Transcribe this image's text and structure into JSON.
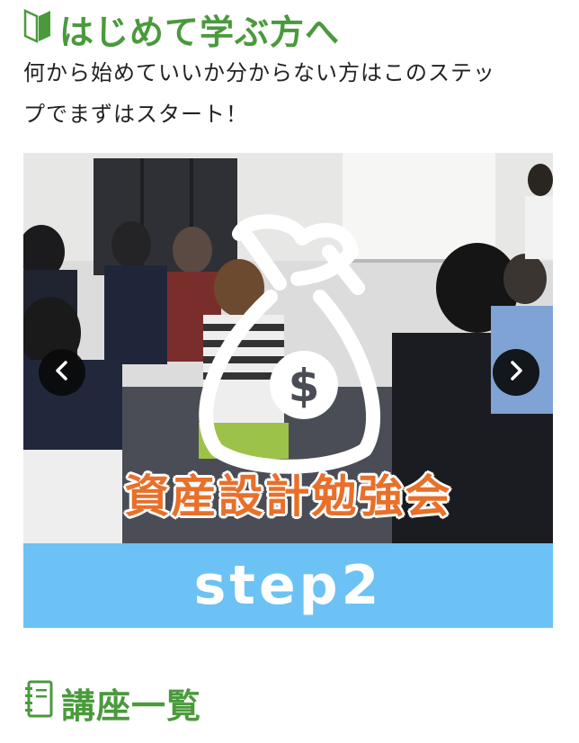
{
  "beginner_section": {
    "heading": "はじめて学ぶ方へ",
    "heading_icon": "beginner-leaf-icon",
    "intro_line_1": "何から始めていいか分からない方はこのステッ",
    "intro_line_2": "プでまずはスタート！"
  },
  "slider": {
    "slide_title": "資産設計勉強会",
    "step_label": "step2",
    "prev_icon": "chevron-left-icon",
    "next_icon": "chevron-right-icon",
    "band_color": "#6cc2f4",
    "title_color": "#e8702a"
  },
  "course_section": {
    "heading": "講座一覧",
    "heading_icon": "notebook-icon"
  },
  "colors": {
    "accent_green": "#4a9a3c"
  }
}
